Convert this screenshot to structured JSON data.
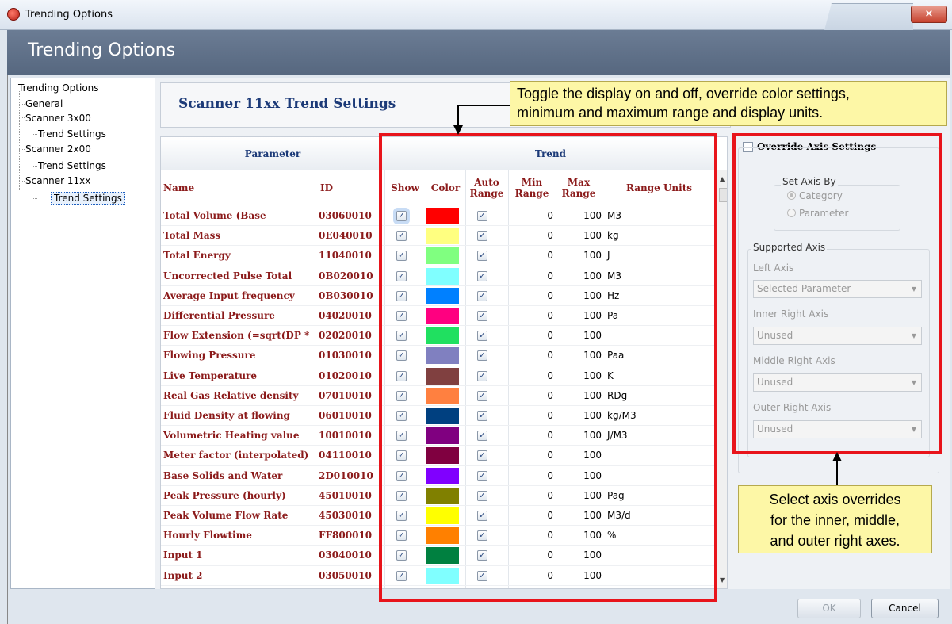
{
  "window": {
    "title": "Trending Options",
    "close_glyph": "×"
  },
  "header": {
    "title": "Trending Options"
  },
  "tree": {
    "root": "Trending Options",
    "items": [
      "General",
      "Scanner 3x00",
      "Trend Settings",
      "Scanner 2x00",
      "Trend Settings",
      "Scanner 11xx",
      "Trend Settings"
    ]
  },
  "settings": {
    "title": "Scanner 11xx Trend Settings"
  },
  "grid": {
    "group_parameter": "Parameter",
    "group_trend": "Trend",
    "columns": {
      "name": "Name",
      "id": "ID",
      "show": "Show",
      "color": "Color",
      "auto_range": "Auto Range",
      "min_range": "Min Range",
      "max_range": "Max Range",
      "range_units": "Range Units"
    },
    "rows": [
      {
        "name": "Total Volume (Base",
        "id": "03060010",
        "show": true,
        "color": "#ff0000",
        "auto": true,
        "min": "0",
        "max": "100",
        "units": "M3"
      },
      {
        "name": "Total Mass",
        "id": "0E040010",
        "show": true,
        "color": "#ffff80",
        "auto": true,
        "min": "0",
        "max": "100",
        "units": "kg"
      },
      {
        "name": "Total Energy",
        "id": "11040010",
        "show": true,
        "color": "#80ff80",
        "auto": true,
        "min": "0",
        "max": "100",
        "units": "J"
      },
      {
        "name": "Uncorrected Pulse Total",
        "id": "0B020010",
        "show": true,
        "color": "#80ffff",
        "auto": true,
        "min": "0",
        "max": "100",
        "units": "M3"
      },
      {
        "name": "Average Input frequency",
        "id": "0B030010",
        "show": true,
        "color": "#0080ff",
        "auto": true,
        "min": "0",
        "max": "100",
        "units": "Hz"
      },
      {
        "name": "Differential Pressure",
        "id": "04020010",
        "show": true,
        "color": "#ff0080",
        "auto": true,
        "min": "0",
        "max": "100",
        "units": "Pa"
      },
      {
        "name": "Flow Extension (=sqrt(DP *",
        "id": "02020010",
        "show": true,
        "color": "#20e060",
        "auto": true,
        "min": "0",
        "max": "100",
        "units": ""
      },
      {
        "name": "Flowing Pressure",
        "id": "01030010",
        "show": true,
        "color": "#8080c0",
        "auto": true,
        "min": "0",
        "max": "100",
        "units": "Paa"
      },
      {
        "name": "Live Temperature",
        "id": "01020010",
        "show": true,
        "color": "#804040",
        "auto": true,
        "min": "0",
        "max": "100",
        "units": "K"
      },
      {
        "name": "Real Gas Relative density",
        "id": "07010010",
        "show": true,
        "color": "#ff8040",
        "auto": true,
        "min": "0",
        "max": "100",
        "units": "RDg"
      },
      {
        "name": "Fluid Density at flowing",
        "id": "06010010",
        "show": true,
        "color": "#004080",
        "auto": true,
        "min": "0",
        "max": "100",
        "units": "kg/M3"
      },
      {
        "name": "Volumetric Heating value",
        "id": "10010010",
        "show": true,
        "color": "#800080",
        "auto": true,
        "min": "0",
        "max": "100",
        "units": "J/M3"
      },
      {
        "name": "Meter factor (interpolated)",
        "id": "04110010",
        "show": true,
        "color": "#800040",
        "auto": true,
        "min": "0",
        "max": "100",
        "units": ""
      },
      {
        "name": "Base Solids and Water",
        "id": "2D010010",
        "show": true,
        "color": "#8000ff",
        "auto": true,
        "min": "0",
        "max": "100",
        "units": ""
      },
      {
        "name": "Peak Pressure (hourly)",
        "id": "45010010",
        "show": true,
        "color": "#808000",
        "auto": true,
        "min": "0",
        "max": "100",
        "units": "Pag"
      },
      {
        "name": "Peak Volume Flow Rate",
        "id": "45030010",
        "show": true,
        "color": "#ffff00",
        "auto": true,
        "min": "0",
        "max": "100",
        "units": "M3/d"
      },
      {
        "name": "Hourly Flowtime",
        "id": "FF800010",
        "show": true,
        "color": "#ff8000",
        "auto": true,
        "min": "0",
        "max": "100",
        "units": "%"
      },
      {
        "name": "Input 1",
        "id": "03040010",
        "show": true,
        "color": "#008040",
        "auto": true,
        "min": "0",
        "max": "100",
        "units": ""
      },
      {
        "name": "Input 2",
        "id": "03050010",
        "show": true,
        "color": "#80ffff",
        "auto": true,
        "min": "0",
        "max": "100",
        "units": ""
      }
    ],
    "check_glyph": "✓"
  },
  "axis": {
    "override_label": "Override Axis Settings",
    "set_axis_by": "Set Axis By",
    "radio_category": "Category",
    "radio_parameter": "Parameter",
    "supported_axis": "Supported Axis",
    "left_axis_label": "Left Axis",
    "left_axis_value": "Selected Parameter",
    "inner_right_label": "Inner Right Axis",
    "inner_right_value": "Unused",
    "middle_right_label": "Middle Right Axis",
    "middle_right_value": "Unused",
    "outer_right_label": "Outer Right Axis",
    "outer_right_value": "Unused"
  },
  "callouts": {
    "top": "Toggle the display on and off, override color settings,\nminimum and maximum range and display units.",
    "right": "Select axis overrides\nfor the inner, middle,\nand outer right axes."
  },
  "buttons": {
    "ok": "OK",
    "cancel": "Cancel"
  },
  "colors": {
    "highlight_red": "#e8141b",
    "callout_bg": "#fdf7a6",
    "header_band": "#5f708a",
    "param_text": "#8b1a1a"
  }
}
